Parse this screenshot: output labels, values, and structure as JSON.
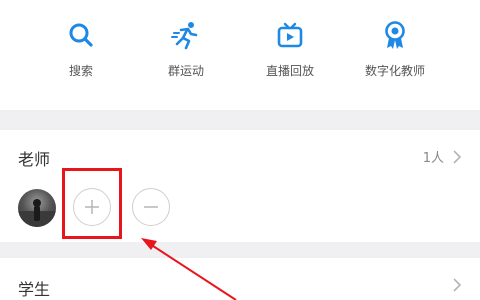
{
  "quick_actions": [
    {
      "label": "搜索",
      "icon": "search-icon"
    },
    {
      "label": "群运动",
      "icon": "running-icon"
    },
    {
      "label": "直播回放",
      "icon": "tv-icon"
    },
    {
      "label": "数字化教师",
      "icon": "badge-icon"
    }
  ],
  "teachers": {
    "title": "老师",
    "count": "1人"
  },
  "students": {
    "title": "学生"
  },
  "colors": {
    "accent": "#1e88e5",
    "highlight": "#e8151b",
    "separator": "#f0f0f2"
  }
}
